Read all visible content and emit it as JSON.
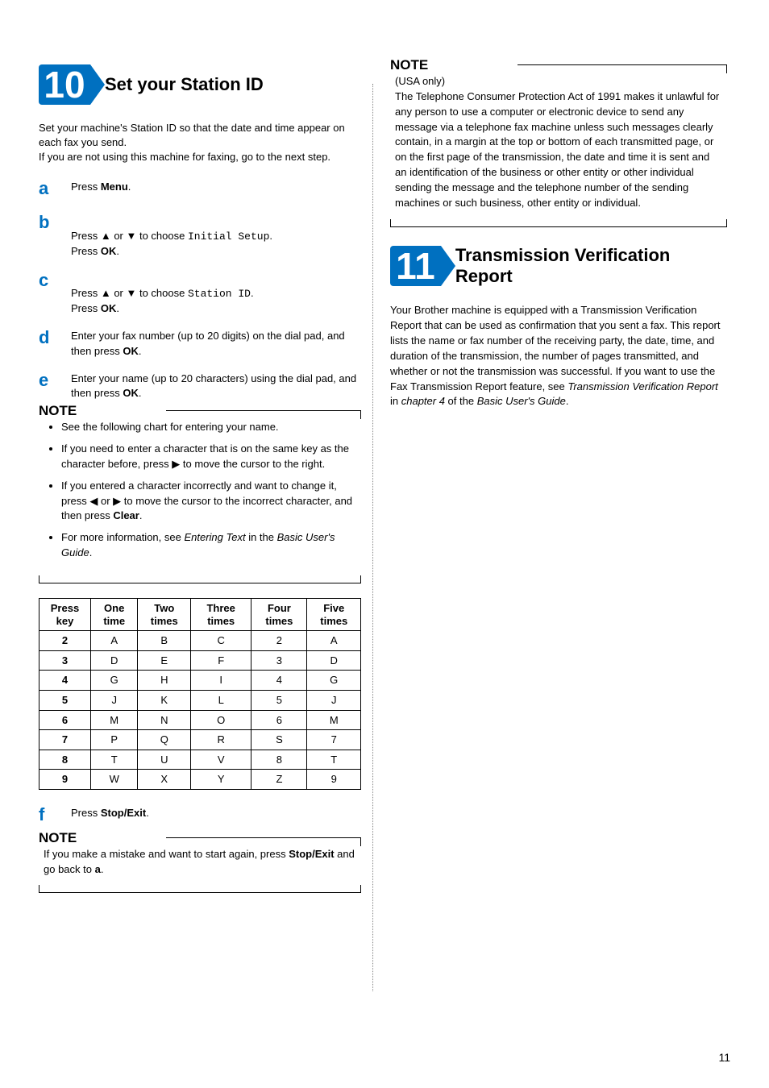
{
  "page_number": "11",
  "left": {
    "step_number": "10",
    "step_title": "Set your Station ID",
    "intro": "Set your machine's Station ID so that the date and time appear on each fax you send.\nIf you are not using this machine for faxing, go to the next step.",
    "substeps": {
      "a": {
        "t1": "Press ",
        "b1": "Menu",
        "t2": "."
      },
      "b": {
        "t1": "Press ▲ or ▼ to choose ",
        "m1": "Initial Setup",
        "t2": ".\nPress ",
        "b1": "OK",
        "t3": "."
      },
      "c": {
        "t1": "Press ▲ or ▼ to choose ",
        "m1": "Station ID",
        "t2": ".\nPress ",
        "b1": "OK",
        "t3": "."
      },
      "d": {
        "t1": "Enter your fax number (up to 20 digits) on the dial pad, and then press ",
        "b1": "OK",
        "t2": "."
      },
      "e": {
        "t1": "Enter your name (up to 20 characters) using the dial pad, and then press ",
        "b1": "OK",
        "t2": "."
      },
      "f": {
        "t1": "Press ",
        "b1": "Stop/Exit",
        "t2": "."
      }
    },
    "note1": {
      "heading": "NOTE",
      "li1": "See the following chart for entering your name.",
      "li2": "If you need to enter a character that is on the same key as the character before, press ▶ to move the cursor to the right.",
      "li3_a": "If you entered a character incorrectly and want to change it, press ◀ or ▶ to move the cursor to the incorrect character, and then press ",
      "li3_b": "Clear",
      "li3_c": ".",
      "li4_a": "For more information, see ",
      "li4_b": "Entering Text",
      "li4_c": " in the ",
      "li4_d": "Basic User's Guide",
      "li4_e": "."
    },
    "table": {
      "headers": {
        "c0": "Press key",
        "c1": "One time",
        "c2": "Two times",
        "c3": "Three times",
        "c4": "Four times",
        "c5": "Five times"
      },
      "rows": [
        {
          "k": "2",
          "c1": "A",
          "c2": "B",
          "c3": "C",
          "c4": "2",
          "c5": "A"
        },
        {
          "k": "3",
          "c1": "D",
          "c2": "E",
          "c3": "F",
          "c4": "3",
          "c5": "D"
        },
        {
          "k": "4",
          "c1": "G",
          "c2": "H",
          "c3": "I",
          "c4": "4",
          "c5": "G"
        },
        {
          "k": "5",
          "c1": "J",
          "c2": "K",
          "c3": "L",
          "c4": "5",
          "c5": "J"
        },
        {
          "k": "6",
          "c1": "M",
          "c2": "N",
          "c3": "O",
          "c4": "6",
          "c5": "M"
        },
        {
          "k": "7",
          "c1": "P",
          "c2": "Q",
          "c3": "R",
          "c4": "S",
          "c5": "7"
        },
        {
          "k": "8",
          "c1": "T",
          "c2": "U",
          "c3": "V",
          "c4": "8",
          "c5": "T"
        },
        {
          "k": "9",
          "c1": "W",
          "c2": "X",
          "c3": "Y",
          "c4": "Z",
          "c5": "9"
        }
      ]
    },
    "note2": {
      "heading": "NOTE",
      "t1": "If you make a mistake and want to start again, press ",
      "b1": "Stop/Exit",
      "t2": " and go back to ",
      "b2": "a",
      "t3": "."
    }
  },
  "right": {
    "note": {
      "heading": "NOTE",
      "sub": "(USA only)",
      "body": "The Telephone Consumer Protection Act of 1991 makes it unlawful for any person to use a computer or electronic device to send any message via a telephone fax machine unless such messages clearly contain, in a margin at the top or bottom of each transmitted page, or on the first page of the transmission, the date and time it is sent and an identification of the business or other entity or other individual sending the message and the telephone number of the sending machines or such business, other entity or individual."
    },
    "step_number": "11",
    "step_title": "Transmission Verification Report",
    "body_a": "Your Brother machine is equipped with a Transmission Verification Report that can be used as confirmation that you sent a fax. This report lists the name or fax number of the receiving party, the date, time, and duration of the transmission, the number of pages transmitted, and whether or not the transmission was successful. If you want to use the Fax Transmission Report feature, see ",
    "body_b": "Transmission Verification Report",
    "body_c": " in ",
    "body_d": "chapter 4",
    "body_e": " of the ",
    "body_f": "Basic User's Guide",
    "body_g": "."
  }
}
